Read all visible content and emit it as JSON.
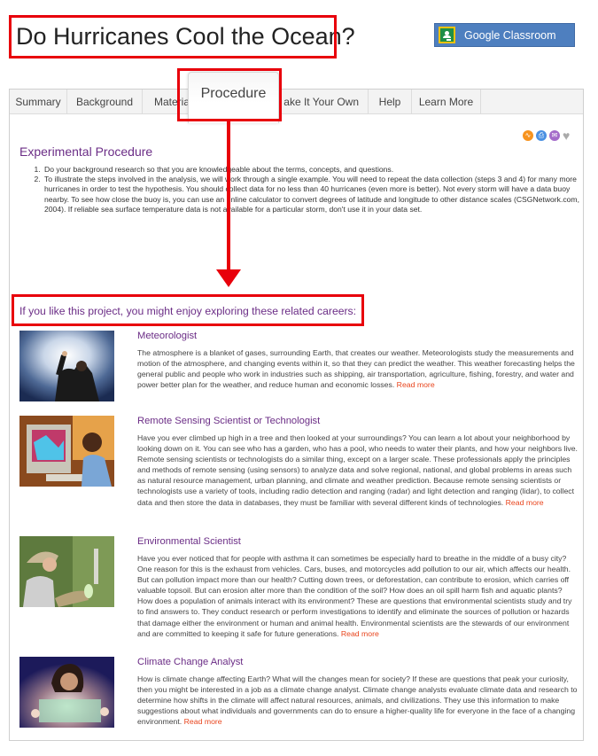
{
  "page": {
    "title": "Do Hurricanes Cool the Ocean?"
  },
  "google_classroom": {
    "label": "Google Classroom",
    "icon": "google-classroom-icon"
  },
  "tabs": [
    {
      "label": "Summary",
      "active": false
    },
    {
      "label": "Background",
      "active": false
    },
    {
      "label": "Materials",
      "active": false
    },
    {
      "label": "Procedure",
      "active": true
    },
    {
      "label": "Make It Your Own",
      "active": false
    },
    {
      "label": "Help",
      "active": false
    },
    {
      "label": "Learn More",
      "active": false
    }
  ],
  "share_icons": [
    {
      "name": "share-icon",
      "color": "#f7931e",
      "glyph": "∿"
    },
    {
      "name": "print-icon",
      "color": "#4a90e2",
      "glyph": "⎙"
    },
    {
      "name": "email-icon",
      "color": "#a46bc9",
      "glyph": "✉"
    },
    {
      "name": "favorite-heart-icon",
      "color": "#aaaaaa",
      "glyph": "♥"
    }
  ],
  "procedure": {
    "heading": "Experimental Procedure",
    "steps": [
      "Do your background research so that you are knowledgeable about the terms, concepts, and questions.",
      "To illustrate the steps involved in the analysis, we will work through a single example. You will need to repeat the data collection (steps 3 and 4) for many more hurricanes in order to test the hypothesis. You should collect data for no less than 40 hurricanes (even more is better). Not every storm will have a data buoy nearby. To see how close the buoy is, you can use an online calculator to convert degrees of latitude and longitude to other distance scales (CSGNetwork.com, 2004). If reliable sea surface temperature data is not available for a particular storm, don't use it in your data set."
    ]
  },
  "careers": {
    "heading": "If you like this project, you might enjoy exploring these related careers:",
    "read_more_label": "Read more",
    "items": [
      {
        "title": "Meteorologist",
        "image": "meteorologist-photo",
        "description": "The atmosphere is a blanket of gases, surrounding Earth, that creates our weather. Meteorologists study the measurements and motion of the atmosphere, and changing events within it, so that they can predict the weather. This weather forecasting helps the general public and people who work in industries such as shipping, air transportation, agriculture, fishing, forestry, and water and power better plan for the weather, and reduce human and economic losses."
      },
      {
        "title": "Remote Sensing Scientist or Technologist",
        "image": "remote-sensing-photo",
        "description": "Have you ever climbed up high in a tree and then looked at your surroundings? You can learn a lot about your neighborhood by looking down on it. You can see who has a garden, who has a pool, who needs to water their plants, and how your neighbors live. Remote sensing scientists or technologists do a similar thing, except on a larger scale. These professionals apply the principles and methods of remote sensing (using sensors) to analyze data and solve regional, national, and global problems in areas such as natural resource management, urban planning, and climate and weather prediction. Because remote sensing scientists or technologists use a variety of tools, including radio detection and ranging (radar) and light detection and ranging (lidar), to collect data and then store the data in databases, they must be familiar with several different kinds of technologies."
      },
      {
        "title": "Environmental Scientist",
        "image": "environmental-scientist-photo",
        "description": "Have you ever noticed that for people with asthma it can sometimes be especially hard to breathe in the middle of a busy city? One reason for this is the exhaust from vehicles. Cars, buses, and motorcycles add pollution to our air, which affects our health. But can pollution impact more than our health? Cutting down trees, or deforestation, can contribute to erosion, which carries off valuable topsoil. But can erosion alter more than the condition of the soil? How does an oil spill harm fish and aquatic plants? How does a population of animals interact with its environment? These are questions that environmental scientists study and try to find answers to. They conduct research or perform investigations to identify and eliminate the sources of pollution or hazards that damage either the environment or human and animal health. Environmental scientists are the stewards of our environment and are committed to keeping it safe for future generations."
      },
      {
        "title": "Climate Change Analyst",
        "image": "climate-change-analyst-photo",
        "description": "How is climate change affecting Earth? What will the changes mean for society? If these are questions that peak your curiosity, then you might be interested in a job as a climate change analyst. Climate change analysts evaluate climate data and research to determine how shifts in the climate will affect natural resources, animals, and civilizations. They use this information to make suggestions about what individuals and governments can do to ensure a higher-quality life for everyone in the face of a changing environment."
      }
    ]
  },
  "annotations": {
    "highlight_color": "#e8000b"
  }
}
